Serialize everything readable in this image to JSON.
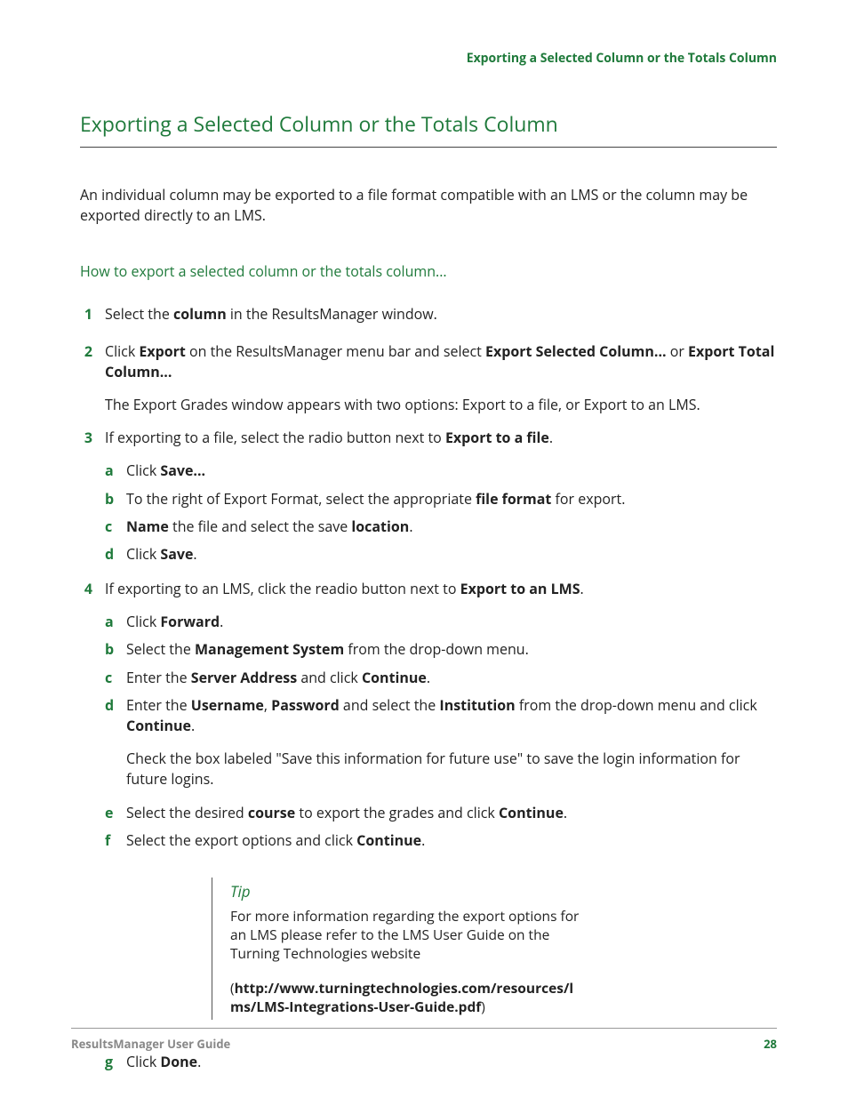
{
  "runningHead": "Exporting a Selected Column or the Totals Column",
  "title": "Exporting a Selected Column or the Totals Column",
  "intro": "An individual column may be exported to a file format compatible with an LMS or the column may be exported directly to an LMS.",
  "howto": "How to export a selected column or the totals column...",
  "steps": {
    "s1": {
      "num": "1",
      "a": "Select the ",
      "b": "column",
      "c": " in the ResultsManager window."
    },
    "s2": {
      "num": "2",
      "a": "Click ",
      "b": "Export",
      "c": " on the ResultsManager menu bar and select ",
      "d": "Export Selected Column...",
      "e": " or ",
      "f": "Export Total Column...",
      "note": "The Export Grades window appears with two options: Export to a file, or Export to an LMS."
    },
    "s3": {
      "num": "3",
      "a": "If exporting to a file, select the radio button next to ",
      "b": "Export to a file",
      "c": ".",
      "sub": {
        "a": {
          "l": "a",
          "t1": "Click ",
          "b1": "Save..."
        },
        "b": {
          "l": "b",
          "t1": "To the right of Export Format, select the appropriate ",
          "b1": "file format",
          "t2": " for export."
        },
        "c": {
          "l": "c",
          "b1": "Name",
          "t1": " the file and select the save ",
          "b2": "location",
          "t2": "."
        },
        "d": {
          "l": "d",
          "t1": "Click ",
          "b1": "Save",
          "t2": "."
        }
      }
    },
    "s4": {
      "num": "4",
      "a": "If exporting to an LMS, click the readio button next to ",
      "b": "Export to an LMS",
      "c": ".",
      "sub": {
        "a": {
          "l": "a",
          "t1": "Click ",
          "b1": "Forward",
          "t2": "."
        },
        "b": {
          "l": "b",
          "t1": "Select the ",
          "b1": "Management System",
          "t2": " from the drop-down menu."
        },
        "c": {
          "l": "c",
          "t1": "Enter the ",
          "b1": "Server Address",
          "t2": " and click ",
          "b2": "Continue",
          "t3": "."
        },
        "d": {
          "l": "d",
          "t1": "Enter the ",
          "b1": "Username",
          "t2": ", ",
          "b2": "Password",
          "t3": " and select the ",
          "b3": "Institution",
          "t4": " from the drop-down menu and click ",
          "b4": "Continue",
          "t5": ".",
          "note": "Check the box labeled \"Save this information for future use\" to save the login information for future logins."
        },
        "e": {
          "l": "e",
          "t1": "Select the desired ",
          "b1": "course",
          "t2": " to export the grades and click ",
          "b2": "Continue",
          "t3": "."
        },
        "f": {
          "l": "f",
          "t1": "Select the export options and click ",
          "b1": "Continue",
          "t2": "."
        },
        "g": {
          "l": "g",
          "t1": "Click ",
          "b1": "Done",
          "t2": "."
        }
      }
    }
  },
  "tip": {
    "head": "Tip",
    "text": "For more information regarding the export options for an LMS please refer to the LMS User Guide on the Turning Technologies website",
    "urlOpen": "(",
    "url": "http://www.turningtechnologies.com/resources/lms/LMS-Integrations-User-Guide.pdf",
    "urlClose": ")"
  },
  "footer": {
    "left": "ResultsManager User Guide",
    "page": "28"
  }
}
